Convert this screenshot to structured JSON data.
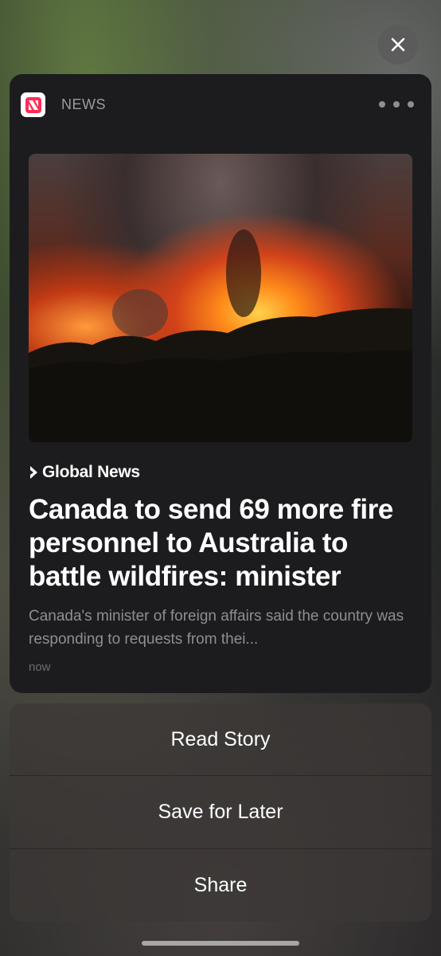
{
  "close": {
    "icon": "close-icon"
  },
  "notification": {
    "app_name": "NEWS",
    "app_icon": "apple-news-icon",
    "more_icon": "ellipsis-icon",
    "source_name": "Global News",
    "headline": "Canada to send 69 more fire personnel to Australia to battle wildfires: minister",
    "summary": "Canada's minister of foreign affairs said the country was responding to requests from thei...",
    "time": "now"
  },
  "actions": [
    {
      "label": "Read Story"
    },
    {
      "label": "Save for Later"
    },
    {
      "label": "Share"
    }
  ],
  "colors": {
    "card_bg": "#1c1c1e",
    "app_icon_accent": "#ff2d55",
    "text_primary": "#ffffff",
    "text_secondary": "#8e8e93"
  }
}
